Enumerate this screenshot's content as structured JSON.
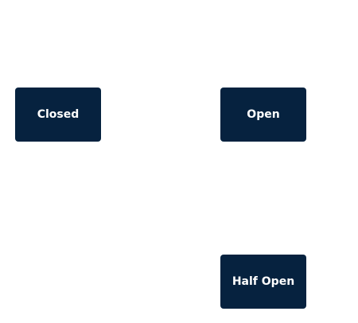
{
  "diagram": {
    "type": "state-diagram",
    "node_color": "#06223f",
    "text_color": "#ffffff",
    "background": "#ffffff",
    "nodes": [
      {
        "id": "closed",
        "label": "Closed"
      },
      {
        "id": "open",
        "label": "Open"
      },
      {
        "id": "half_open",
        "label": "Half Open"
      }
    ]
  }
}
